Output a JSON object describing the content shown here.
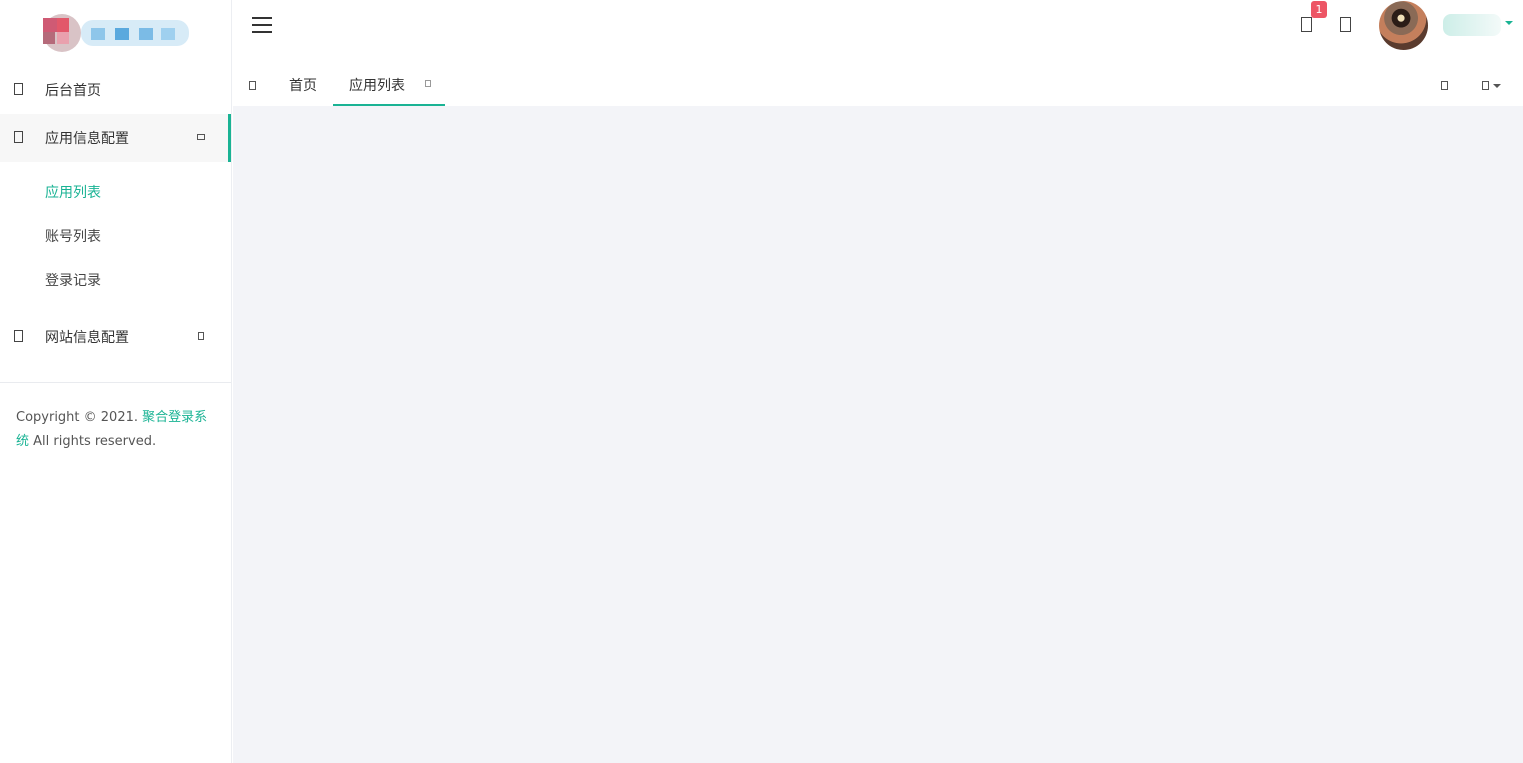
{
  "brand": {
    "logo_name": "pixelated-logo"
  },
  "sidebar": {
    "items": [
      {
        "label": "后台首页",
        "icon": "home-icon"
      },
      {
        "label": "应用信息配置",
        "icon": "app-config-icon",
        "expanded": true
      },
      {
        "label": "网站信息配置",
        "icon": "site-config-icon",
        "expanded": false
      }
    ],
    "submenu": [
      {
        "label": "应用列表",
        "current": true
      },
      {
        "label": "账号列表"
      },
      {
        "label": "登录记录"
      }
    ],
    "copyright_prefix": "Copyright © 2021. ",
    "copyright_brand": "聚合登录系统",
    "copyright_suffix": " All rights reserved."
  },
  "header": {
    "notification_count": "1",
    "icons": [
      "menu-toggle-icon",
      "bell-icon",
      "fullscreen-icon"
    ]
  },
  "tabs": {
    "items": [
      {
        "label": "首页"
      },
      {
        "label": "应用列表",
        "active": true
      }
    ]
  },
  "colors": {
    "accent": "#1ab394",
    "badge": "#ed5565",
    "content_bg": "#f3f4f8"
  }
}
